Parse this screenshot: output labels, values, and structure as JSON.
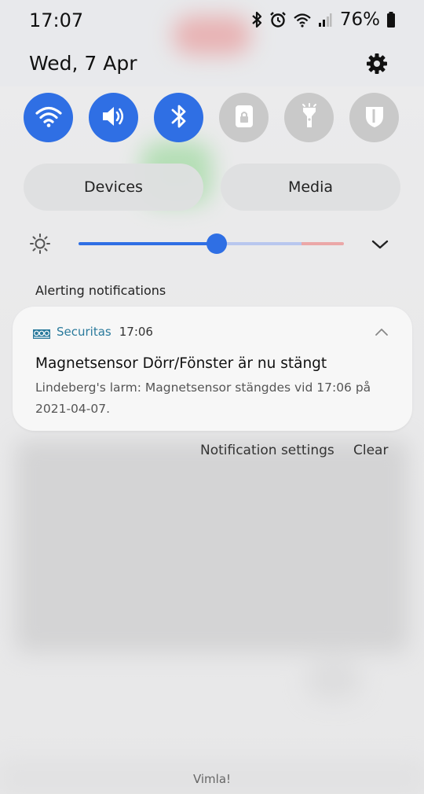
{
  "status_bar": {
    "time": "17:07",
    "battery": "76%",
    "icons": [
      "bluetooth-icon",
      "alarm-icon",
      "wifi-call-icon",
      "signal-icon",
      "battery-icon"
    ]
  },
  "header": {
    "date": "Wed, 7 Apr",
    "settings_icon": "gear-icon"
  },
  "quick_toggles": [
    {
      "name": "wifi",
      "icon": "wifi-icon",
      "state": "on"
    },
    {
      "name": "sound",
      "icon": "speaker-icon",
      "state": "on"
    },
    {
      "name": "bluetooth",
      "icon": "bluetooth-icon",
      "state": "on"
    },
    {
      "name": "screen-lock",
      "icon": "lock-icon",
      "state": "off"
    },
    {
      "name": "flashlight",
      "icon": "flashlight-icon",
      "state": "off"
    },
    {
      "name": "secure-folder",
      "icon": "shield-icon",
      "state": "off"
    }
  ],
  "panel_buttons": {
    "devices": "Devices",
    "media": "Media"
  },
  "brightness": {
    "level": 0.52
  },
  "notifications": {
    "section_label": "Alerting notifications",
    "items": [
      {
        "app_name": "Securitas",
        "time": "17:06",
        "title": "Magnetsensor Dörr/Fönster är nu stängt",
        "body": "Lindeberg's larm: Magnetsensor stängdes vid 17:06 på 2021-04-07."
      }
    ],
    "settings_label": "Notification settings",
    "clear_label": "Clear"
  },
  "bottom_hint": "Vimla!",
  "colors": {
    "accent": "#2f6fe4",
    "toggle_off": "#c9c9c9",
    "app_name": "#2a7a9c"
  }
}
